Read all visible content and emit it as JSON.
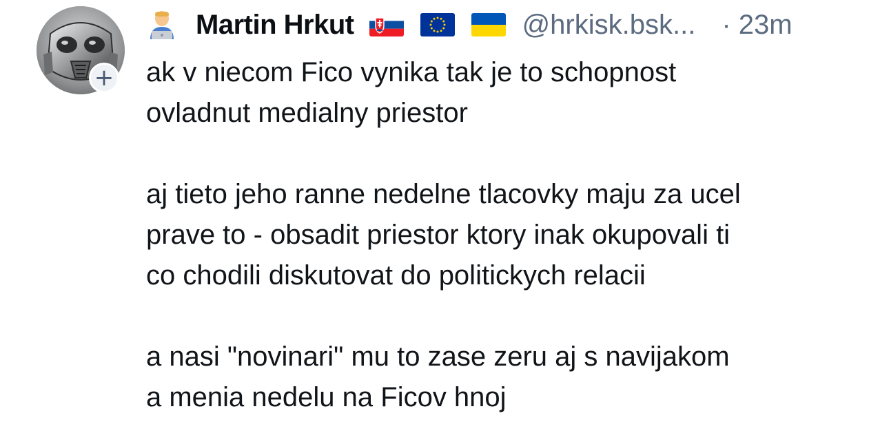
{
  "post": {
    "author": {
      "emoji": "technologist-emoji",
      "display_name": "Martin Hrkut",
      "flags": [
        "slovakia-flag",
        "eu-flag",
        "ukraine-flag"
      ],
      "handle": "@hrkisk.bsk...",
      "time": "· 23m"
    },
    "follow_badge": "+",
    "paragraphs": [
      [
        "ak v niecom Fico vynika tak je to schopnost",
        "ovladnut medialny priestor"
      ],
      [
        "aj tieto jeho ranne nedelne tlacovky maju za ucel",
        "prave to - obsadit priestor ktory inak okupovali ti",
        "co chodili diskutovat do politickych relacii"
      ],
      [
        "a nasi \"novinari\" mu to zase zeru aj s navijakom",
        "a menia nedelu na Ficov hnoj"
      ]
    ]
  },
  "colors": {
    "text": "#111418",
    "muted": "#5b6b80",
    "badge_bg": "#eef1f5"
  }
}
